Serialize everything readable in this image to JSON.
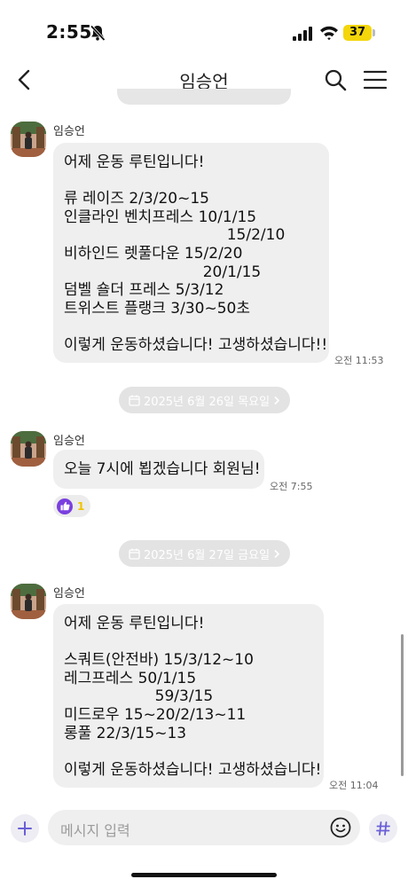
{
  "status_bar": {
    "time": "2:55",
    "battery": "37"
  },
  "header": {
    "title": "임승언"
  },
  "input": {
    "placeholder": "메시지 입력"
  },
  "messages": [
    {
      "sender": "임승언",
      "lines": [
        "어제 운동 루틴입니다!",
        "",
        "류 레이즈 2/3/20~15",
        "인클라인 벤치프레스 10/1/15",
        "                                  15/2/10",
        "비하인드 렛풀다운 15/2/20",
        "                             20/1/15",
        "덤벨 숄더 프레스 5/3/12",
        "트위스트 플랭크 3/30~50초",
        "",
        "이렇게 운동하셨습니다! 고생하셨습니다!!"
      ],
      "time": "오전 11:53"
    },
    {
      "sender": "임승언",
      "text": "오늘 7시에 뵙겠습니다 회원님!",
      "time": "오전 7:55",
      "reaction_count": "1"
    },
    {
      "sender": "임승언",
      "lines": [
        "어제 운동 루틴입니다!",
        "",
        "스쿼트(안전바) 15/3/12~10",
        "레그프레스 50/1/15",
        "                   59/3/15",
        "미드로우 15~20/2/13~11",
        "롱풀 22/3/15~13",
        "",
        "이렇게 운동하셨습니다! 고생하셨습니다!"
      ],
      "time": "오전 11:04"
    }
  ],
  "date_separators": [
    "2025년 6월 26일 목요일",
    "2025년 6월 27일 금요일"
  ],
  "colors": {
    "bubble": "#efefef",
    "date_pill": "#e3e3e3",
    "accent": "#6a5fd6",
    "battery": "#f4d60b"
  }
}
